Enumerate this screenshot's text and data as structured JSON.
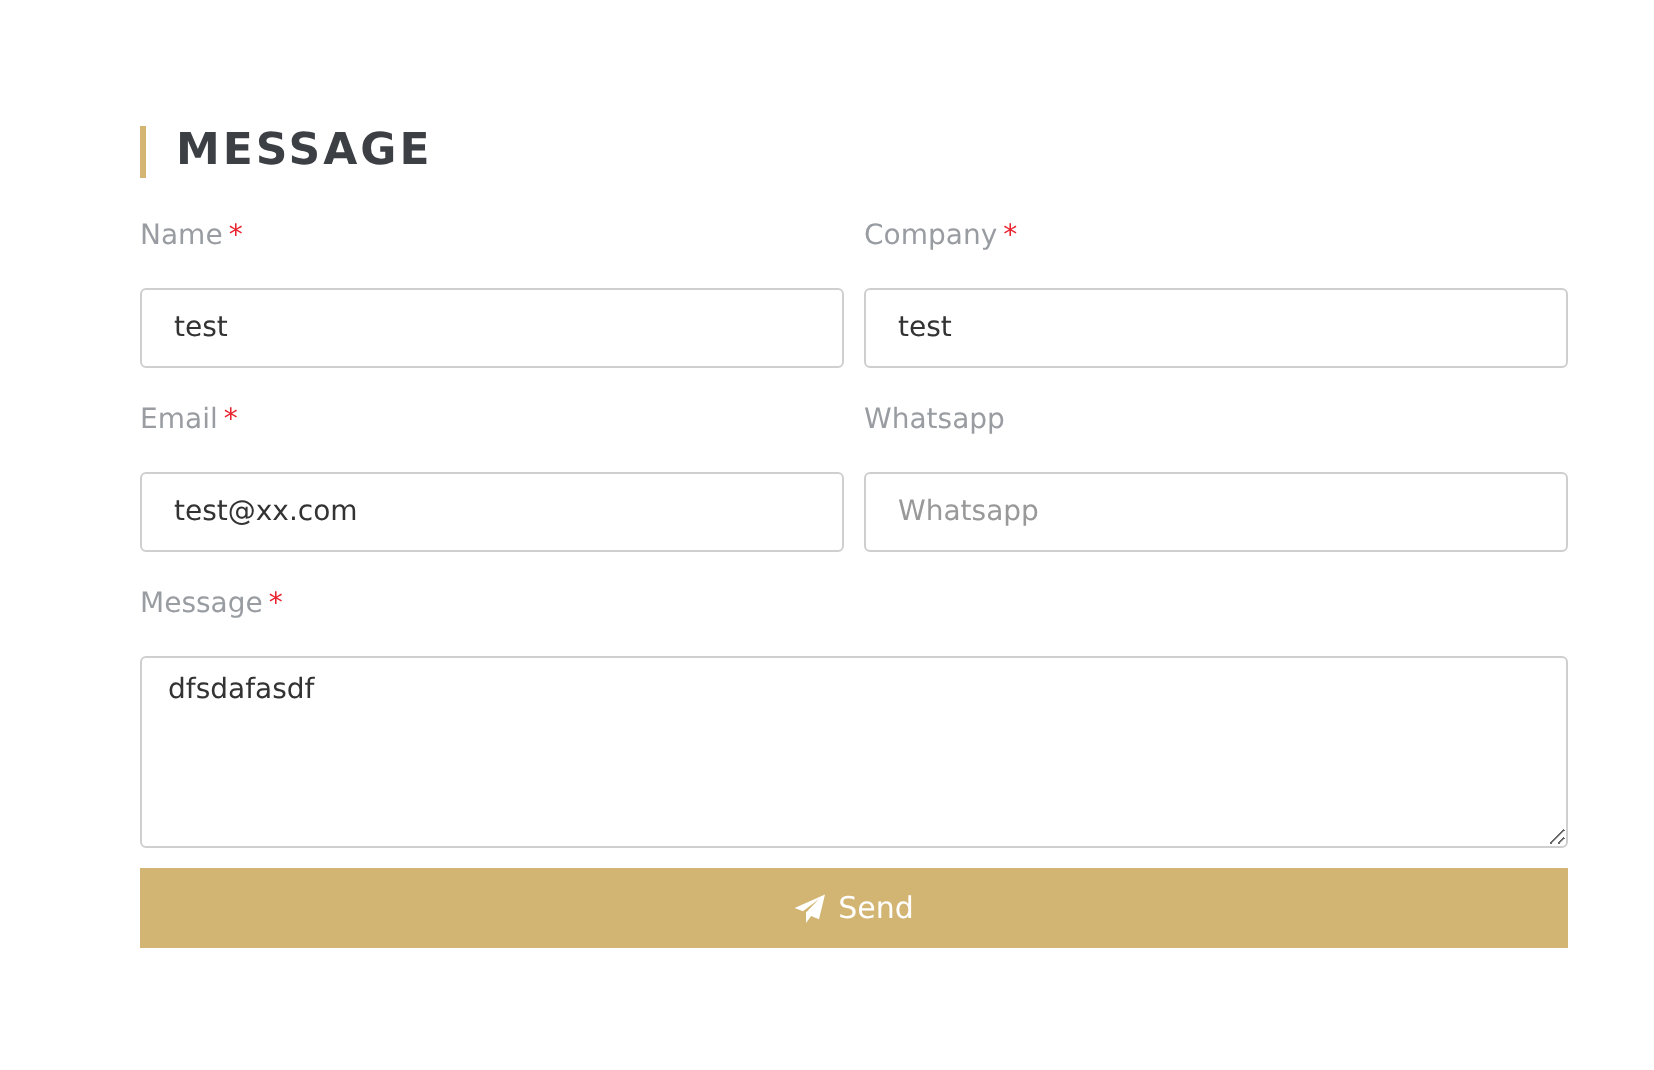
{
  "heading": "MESSAGE",
  "fields": [
    {
      "kind": "input",
      "label": "Name",
      "required_mark": "*",
      "value": "test"
    },
    {
      "kind": "input",
      "label": "Company",
      "required_mark": "*",
      "value": "test"
    },
    {
      "kind": "input",
      "label": "Email",
      "required_mark": "*",
      "value": "test@xx.com"
    },
    {
      "kind": "input",
      "label": "Whatsapp",
      "placeholder": "Whatsapp"
    },
    {
      "kind": "textarea",
      "label": "Message",
      "required_mark": "*",
      "value": "dfsdafasdf"
    }
  ],
  "submit": {
    "label": "Send"
  }
}
